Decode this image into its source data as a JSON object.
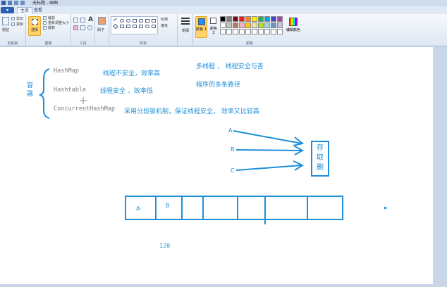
{
  "window": {
    "title": "无标题 - 画图"
  },
  "tabs": {
    "file": "▾",
    "home": "主页",
    "view": "查看"
  },
  "ribbon": {
    "clipboard": {
      "paste": "粘贴",
      "cut": "剪切",
      "copy": "复制",
      "label": "剪贴板"
    },
    "image": {
      "select": "选择",
      "crop": "裁剪",
      "resize": "重新调整大小",
      "rotate": "旋转",
      "label": "图像"
    },
    "tools": {
      "label": "工具"
    },
    "brushes": {
      "label": "刷子"
    },
    "shapes": {
      "outline": "轮廓",
      "fill": "填充",
      "label": "形状"
    },
    "size": {
      "label": "粗细"
    },
    "colors": {
      "color1": "颜色 1",
      "color2": "颜色 2",
      "edit": "编辑颜色",
      "label": "颜色"
    }
  },
  "palette": [
    "#000000",
    "#7f7f7f",
    "#880015",
    "#ed1c24",
    "#ff7f27",
    "#fff200",
    "#22b14c",
    "#00a2e8",
    "#3f48cc",
    "#a349a4",
    "#ffffff",
    "#c3c3c3",
    "#b97a57",
    "#ffaec9",
    "#ffc90e",
    "#efe4b0",
    "#b5e61d",
    "#99d9ea",
    "#7092be",
    "#c8bfe7",
    "#ffffff",
    "#ffffff",
    "#ffffff",
    "#ffffff",
    "#ffffff",
    "#ffffff",
    "#ffffff",
    "#ffffff",
    "#ffffff",
    "#ffffff"
  ],
  "colors": {
    "ink": "#1e8fd8",
    "gray_text": "#7d7d7d",
    "selected_color": "#1e90ff"
  },
  "drawing": {
    "container_label": "容\n器",
    "classes": [
      "HashMap",
      "Hashtable",
      "ConcurrentHashMap"
    ],
    "notes": [
      "线程不安全，效率高",
      "线程安全    ，效率低",
      "采用分段锁机制，保证线程安全，  效率又比较高"
    ],
    "multithread_line1": "多线程 ，   线程安全与否",
    "multithread_line2": "程序的多条路径",
    "threads": [
      "A",
      "B",
      "C"
    ],
    "target": "存\n取\n删",
    "segments": [
      "A·",
      "B"
    ],
    "capacity": "128"
  }
}
